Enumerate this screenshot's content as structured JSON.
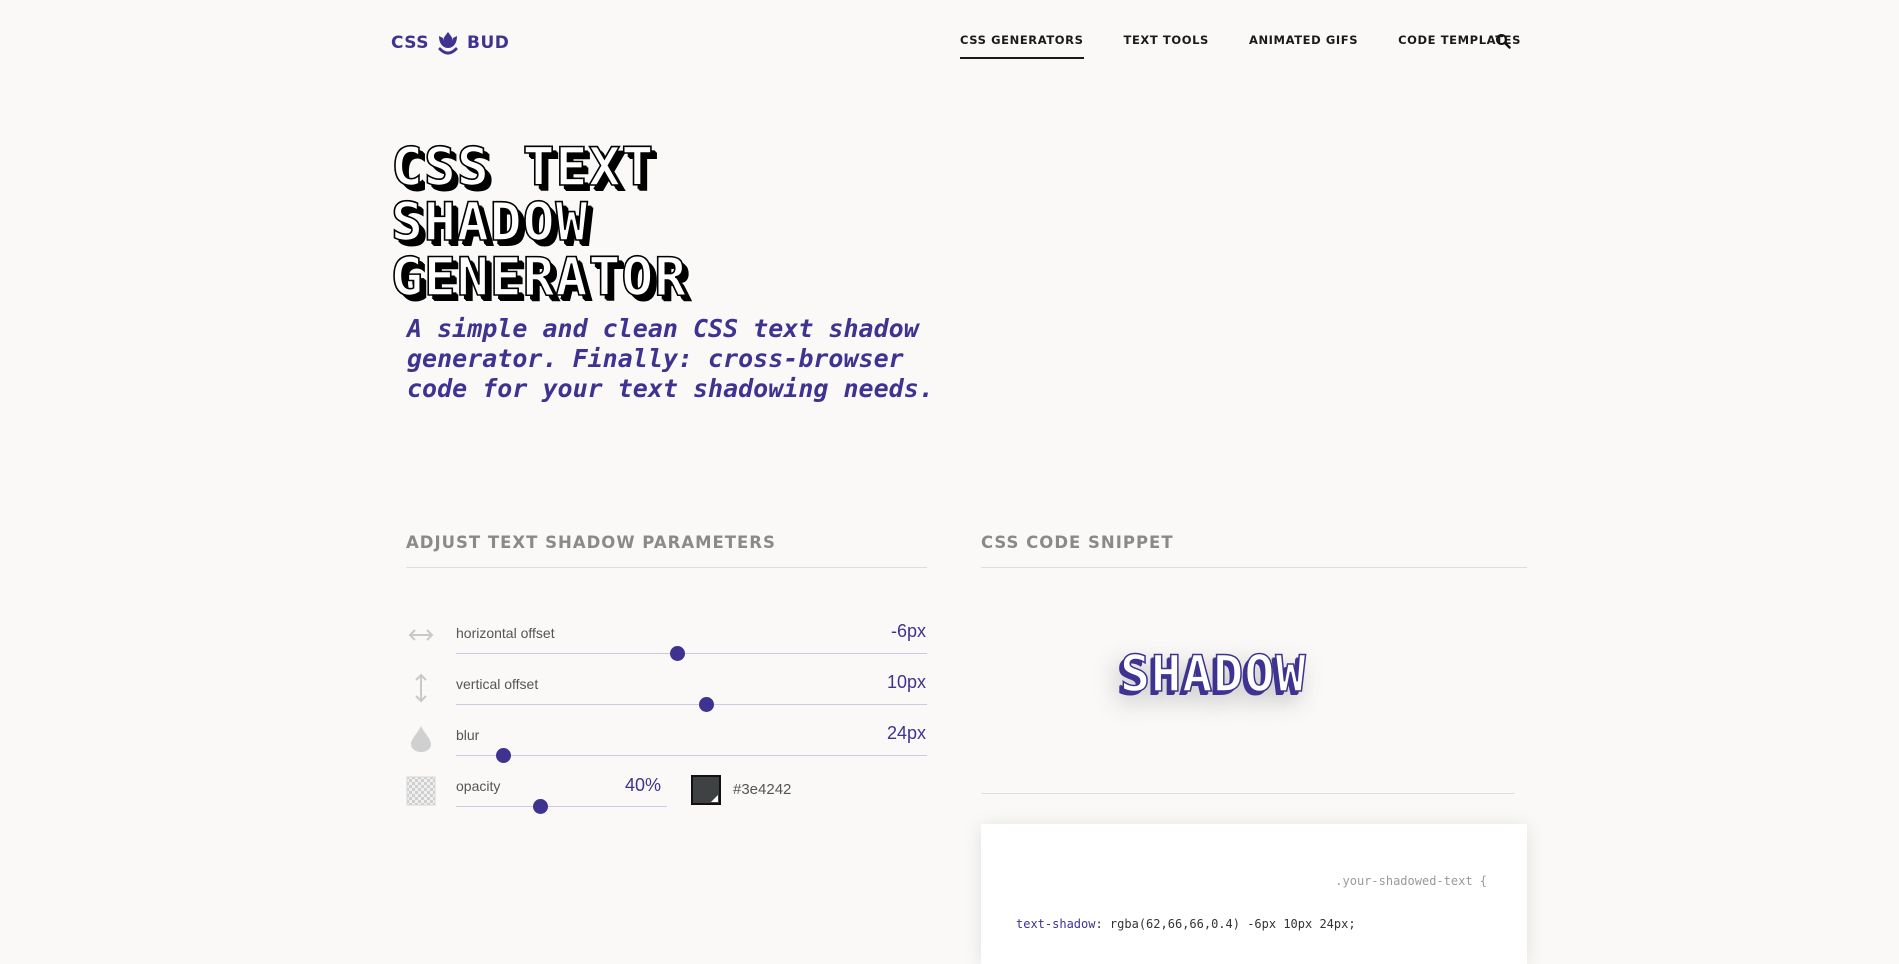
{
  "brand": {
    "left": "CSS",
    "right": "BUD",
    "icon": "tulip-icon",
    "color": "#3f3391"
  },
  "nav": {
    "items": [
      {
        "label": "CSS GENERATORS",
        "active": true
      },
      {
        "label": "TEXT TOOLS",
        "active": false
      },
      {
        "label": "ANIMATED GIFS",
        "active": false
      },
      {
        "label": "CODE TEMPLATES",
        "active": false
      }
    ],
    "search_icon": "search-icon"
  },
  "hero": {
    "title": "CSS TEXT\nSHADOW\nGENERATOR",
    "subtitle": "A simple and clean CSS text shadow generator. Finally: cross-browser code for your text shadowing needs."
  },
  "controls": {
    "heading": "ADJUST TEXT SHADOW PARAMETERS",
    "horizontal": {
      "label": "horizontal offset",
      "value": "-6px",
      "level": 0.47,
      "icon": "horizontal-arrows-icon"
    },
    "vertical": {
      "label": "vertical offset",
      "value": "10px",
      "level": 0.53,
      "icon": "vertical-arrows-icon"
    },
    "blur": {
      "label": "blur",
      "value": "24px",
      "level": 0.1,
      "icon": "drop-icon"
    },
    "opacity": {
      "label": "opacity",
      "value": "40%",
      "level": 0.4,
      "icon": "checkerboard-icon"
    },
    "color": {
      "hex": "#3e4242"
    }
  },
  "snippet": {
    "heading": "CSS CODE SNIPPET",
    "preview_text": "SHADOW",
    "selector": ".your-shadowed-text {",
    "property": "text-shadow",
    "value": ": rgba(62,66,66,0.4) -6px 10px 24px;"
  },
  "colors": {
    "accent": "#3f3391",
    "background": "#faf9f7",
    "muted_heading": "#8a8a8a"
  }
}
